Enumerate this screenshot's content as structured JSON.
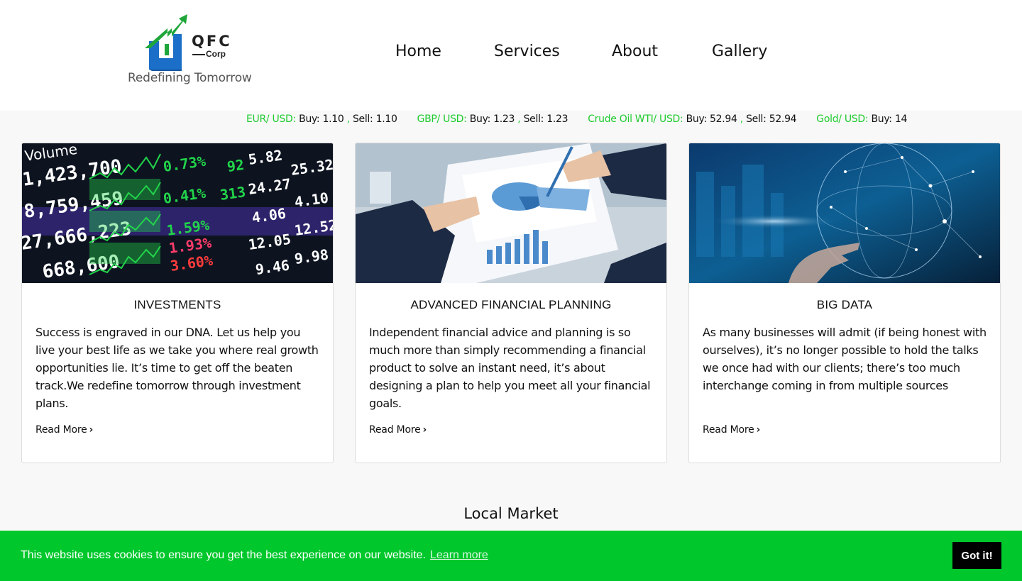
{
  "brand": {
    "logo_text": "QFC",
    "logo_subtext": "Corp",
    "tagline": "Redefining Tomorrow",
    "colors": {
      "green": "#1fa63a",
      "blue": "#1b6fc8"
    }
  },
  "nav": {
    "items": [
      {
        "label": "Home"
      },
      {
        "label": "Services"
      },
      {
        "label": "About"
      },
      {
        "label": "Gallery"
      }
    ]
  },
  "ticker": {
    "items": [
      {
        "pair": "EUR/ USD:",
        "buy": "Buy: 1.10",
        "sep": " ,",
        "sell": "Sell: 1.10"
      },
      {
        "pair": "GBP/ USD:",
        "buy": "Buy: 1.23",
        "sep": " ,",
        "sell": "Sell: 1.23"
      },
      {
        "pair": "Crude Oil WTI/ USD:",
        "buy": "Buy: 52.94",
        "sep": " ,",
        "sell": "Sell: 52.94"
      },
      {
        "pair": "Gold/ USD:",
        "buy": "Buy: 14",
        "sep": "",
        "sell": ""
      }
    ],
    "accent_color": "#1fcb2f"
  },
  "cards": [
    {
      "image": "stock-market-board-image",
      "title": "INVESTMENTS",
      "text": "Success is engraved in our DNA. Let us help you live your best life as we take you where real growth opportunities lie. It’s time to get off the beaten track.We redefine tomorrow through investment plans.",
      "more": "Read More"
    },
    {
      "image": "financial-charts-meeting-image",
      "title": "ADVANCED FINANCIAL PLANNING",
      "text": "Independent financial advice and planning is so much more than simply recommending a financial product to solve an instant need, it’s about designing a plan to help you meet all your financial goals.",
      "more": "Read More"
    },
    {
      "image": "digital-globe-network-image",
      "title": "BIG DATA",
      "text": "As many businesses will admit (if being honest with ourselves), it’s no longer possible to hold the talks we once had with our clients; there’s too much interchange coming in from multiple sources",
      "more": "Read More"
    }
  ],
  "local_market": {
    "title": "Local Market"
  },
  "cookie": {
    "message": "This website uses cookies to ensure you get the best experience on our website.",
    "link": "Learn more",
    "button": "Got it!",
    "bg_color": "#00c72b"
  }
}
